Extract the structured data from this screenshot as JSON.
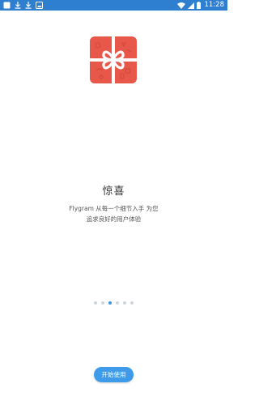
{
  "status_bar": {
    "time": "11:28",
    "background_color": "#2f7fd0",
    "left_icons": [
      "notification-square-icon",
      "download-icon",
      "download-icon",
      "image-notification-icon"
    ],
    "right_icons": [
      "wifi-icon",
      "cellular-signal-icon",
      "battery-icon"
    ]
  },
  "intro": {
    "title": "惊喜",
    "description_line1": "Flygram 从每一个细节入手 为您",
    "description_line2": "追求良好的用户体验",
    "illustration": "gift-box-icon",
    "illustration_color": "#e8584a"
  },
  "pager": {
    "total": 6,
    "current": 3,
    "active_color": "#3a98e6",
    "inactive_color": "#cfd6dd"
  },
  "start_button": {
    "label": "开始使用",
    "color": "#3d9be9"
  }
}
